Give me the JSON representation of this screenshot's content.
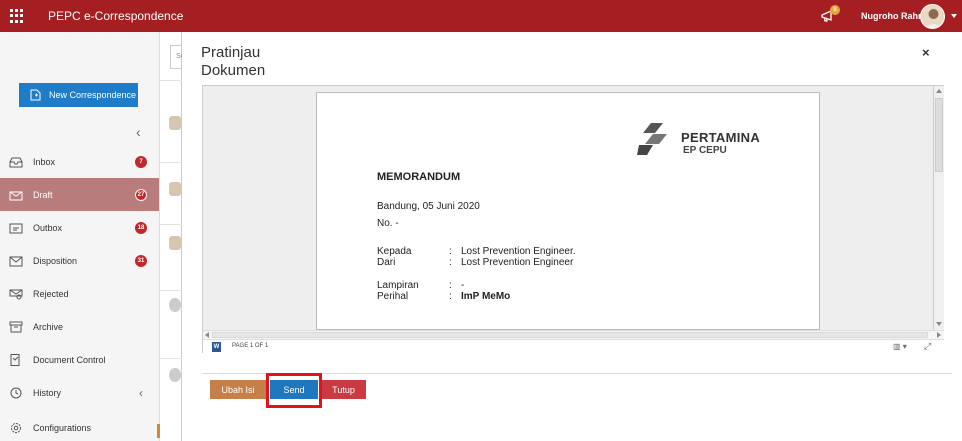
{
  "app": {
    "title": "PEPC e-Correspondence",
    "user_name": "Nugroho Rahm",
    "notification_count": "8",
    "accent_color": "#a51e22"
  },
  "sidebar": {
    "new_button_label": "New Correspondence",
    "items": [
      {
        "label": "Inbox",
        "badge": "7",
        "icon": "inbox-icon"
      },
      {
        "label": "Draft",
        "badge": "27",
        "icon": "draft-icon",
        "active": true
      },
      {
        "label": "Outbox",
        "badge": "18",
        "icon": "outbox-icon"
      },
      {
        "label": "Disposition",
        "badge": "31",
        "icon": "disposition-icon"
      },
      {
        "label": "Rejected",
        "badge": "",
        "icon": "rejected-icon"
      },
      {
        "label": "Archive",
        "badge": "",
        "icon": "archive-icon"
      },
      {
        "label": "Document Control",
        "badge": "",
        "icon": "document-control-icon"
      },
      {
        "label": "History",
        "badge": "",
        "icon": "history-icon"
      },
      {
        "label": "Configurations",
        "badge": "",
        "icon": "gear-icon"
      }
    ]
  },
  "list": {
    "search_placeholder": "Se"
  },
  "modal": {
    "title": "Pratinjau Dokumen",
    "close_glyph": "×",
    "viewer": {
      "page_indicator": "PAGE 1 OF 1"
    },
    "document": {
      "company": "PERTAMINA",
      "company_sub": "EP CEPU",
      "heading": "MEMORANDUM",
      "date_line": "Bandung, 05 Juni 2020",
      "number_line": "No. -",
      "fields": [
        {
          "label": "Kepada",
          "value": "Lost Prevention Engineer.",
          "bold": false
        },
        {
          "label": "Dari",
          "value": "Lost Prevention Engineer",
          "bold": false
        },
        {
          "label": "Lampiran",
          "value": "-",
          "bold": false
        },
        {
          "label": "Perihal",
          "value": "ImP MeMo",
          "bold": true
        }
      ],
      "separator": ":"
    },
    "buttons": {
      "edit": "Ubah Isi",
      "send": "Send",
      "close": "Tutup"
    }
  }
}
